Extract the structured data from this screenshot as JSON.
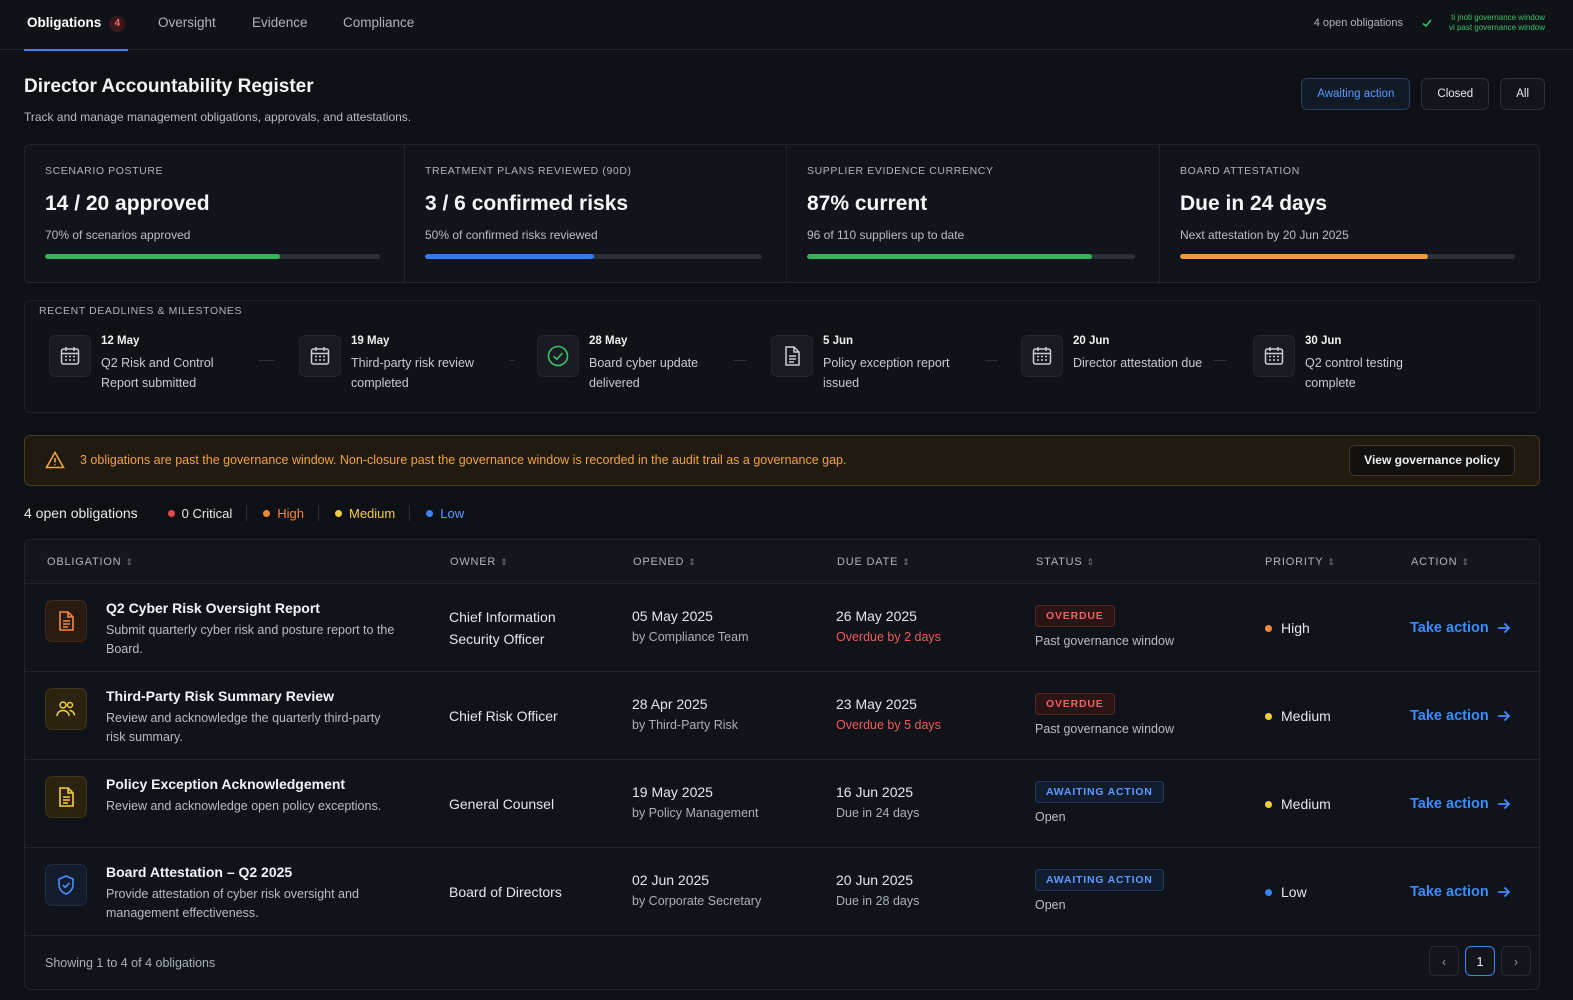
{
  "nav": {
    "tabs": [
      {
        "label": "Obligations",
        "count": "4"
      },
      {
        "label": "Oversight"
      },
      {
        "label": "Evidence"
      },
      {
        "label": "Compliance"
      }
    ],
    "open_count": "4 open obligations",
    "status_line1": "ti jnoti governance window",
    "status_line2": "vi past governance window"
  },
  "header": {
    "title": "Director Accountability Register",
    "subtitle": "Track and manage management obligations, approvals, and attestations.",
    "filters": [
      "Awaiting action",
      "Closed",
      "All"
    ]
  },
  "kpis": [
    {
      "label": "Scenario Posture",
      "value": "14 / 20 approved",
      "desc": "70% of scenarios approved",
      "progress": 0.7,
      "color": "#34b35a"
    },
    {
      "label": "Treatment Plans Reviewed (90D)",
      "value": "3 / 6 confirmed risks",
      "desc": "50% of confirmed risks reviewed",
      "progress": 0.5,
      "color": "#2f7cf0"
    },
    {
      "label": "Supplier Evidence Currency",
      "value": "87% current",
      "desc": "96 of 110 suppliers up to date",
      "progress": 0.87,
      "color": "#34b35a"
    },
    {
      "label": "Board Attestation",
      "value": "Due in 24 days",
      "desc": "Next attestation by 20 Jun 2025",
      "progress": 0.74,
      "color": "#f59a3c"
    }
  ],
  "milestones": {
    "title": "RECENT DEADLINES & MILESTONES",
    "items": [
      {
        "date": "12 May",
        "text": "Q2 Risk and Control Report submitted",
        "icon": "calendar-icon"
      },
      {
        "date": "19 May",
        "text": "Third-party risk review completed",
        "icon": "calendar-icon"
      },
      {
        "date": "28 May",
        "text": "Board cyber update delivered",
        "icon": "check-circle-icon"
      },
      {
        "date": "5 Jun",
        "text": "Policy exception report issued",
        "icon": "document-icon"
      },
      {
        "date": "20 Jun",
        "text": "Director attestation due",
        "icon": "calendar-icon"
      },
      {
        "date": "30 Jun",
        "text": "Q2 control testing complete",
        "icon": "calendar-icon"
      }
    ]
  },
  "alert": {
    "text": "3 obligations are past the governance window. Non-closure past the governance window is recorded in the audit trail as a governance gap.",
    "button": "View governance policy"
  },
  "summary": {
    "total": "4 open obligations",
    "critical": "0 Critical",
    "high": "High",
    "medium": "Medium",
    "low": "Low",
    "colors": {
      "critical": "#e5484d",
      "high": "#f5883a",
      "medium": "#f5cf3a",
      "low": "#3b82f6"
    }
  },
  "table": {
    "columns": [
      "OBLIGATION",
      "OWNER",
      "OPENED",
      "DUE DATE",
      "STATUS",
      "PRIORITY",
      "ACTION"
    ],
    "rows": [
      {
        "title": "Q2 Cyber Risk Oversight Report",
        "desc": "Submit quarterly cyber risk and posture report to the Board.",
        "icon": "report-icon",
        "owner": "Chief Information Security Officer",
        "opened": "05 May 2025",
        "opened_by": "by Compliance Team",
        "due": "26 May 2025",
        "due_sub": "Overdue by 2 days",
        "status": "OVERDUE",
        "status_sub": "Past governance window",
        "priority": "High",
        "priority_color": "#f5883a",
        "action": "Take action"
      },
      {
        "title": "Third-Party Risk Summary Review",
        "desc": "Review and acknowledge the quarterly third-party risk summary.",
        "icon": "users-icon",
        "owner": "Chief Risk Officer",
        "opened": "28 Apr 2025",
        "opened_by": "by Third-Party Risk",
        "due": "23 May 2025",
        "due_sub": "Overdue by 5 days",
        "status": "OVERDUE",
        "status_sub": "Past governance window",
        "priority": "Medium",
        "priority_color": "#f5cf3a",
        "action": "Take action"
      },
      {
        "title": "Policy Exception Acknowledgement",
        "desc": "Review and acknowledge open policy exceptions.",
        "icon": "policy-document-icon",
        "owner": "General Counsel",
        "opened": "19 May 2025",
        "opened_by": "by Policy Management",
        "due": "16 Jun 2025",
        "due_sub": "Due in 24 days",
        "status": "AWAITING ACTION",
        "status_sub": "Open",
        "priority": "Medium",
        "priority_color": "#f5cf3a",
        "action": "Take action"
      },
      {
        "title": "Board Attestation – Q2 2025",
        "desc": "Provide attestation of cyber risk oversight and management effectiveness.",
        "icon": "shield-check-icon",
        "owner": "Board of Directors",
        "opened": "02 Jun 2025",
        "opened_by": "by Corporate Secretary",
        "due": "20 Jun 2025",
        "due_sub": "Due in 28 days",
        "status": "AWAITING ACTION",
        "status_sub": "Open",
        "priority": "Low",
        "priority_color": "#3b82f6",
        "action": "Take action"
      }
    ],
    "footer": "Showing 1 to 4 of 4 obligations",
    "page": "1"
  }
}
